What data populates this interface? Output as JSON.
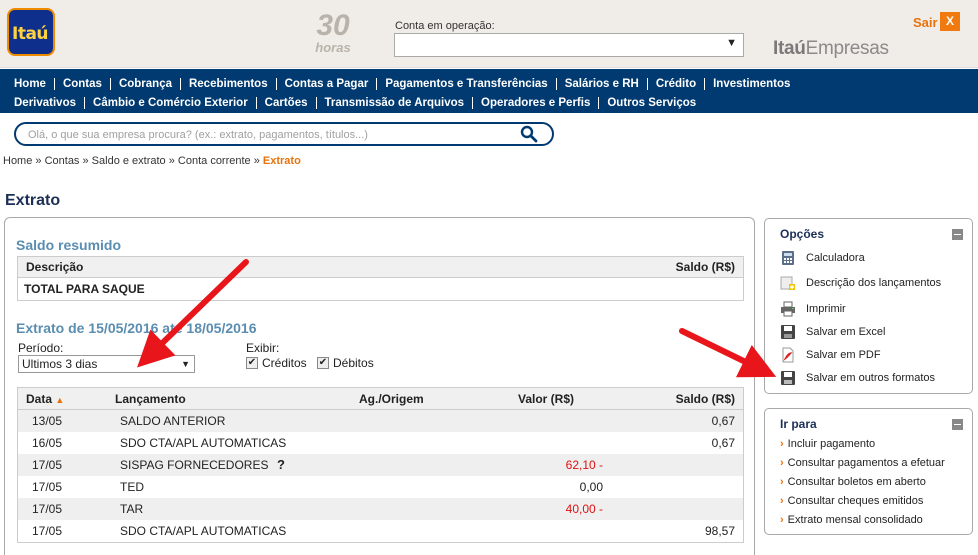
{
  "header": {
    "logo_text": "Itaú",
    "thirty": {
      "number": "30",
      "label": "horas"
    },
    "account_label": "Conta em operação:",
    "account_value": "",
    "brand_a": "Itaú",
    "brand_b": "Empresas",
    "logout_label": "Sair",
    "logout_x": "X"
  },
  "nav": {
    "row1": [
      "Home",
      "Contas",
      "Cobrança",
      "Recebimentos",
      "Contas a Pagar",
      "Pagamentos e Transferências",
      "Salários e RH",
      "Crédito",
      "Investimentos"
    ],
    "row2": [
      "Derivativos",
      "Câmbio e Comércio Exterior",
      "Cartões",
      "Transmissão de Arquivos",
      "Operadores e Perfis",
      "Outros Serviços"
    ]
  },
  "search": {
    "placeholder": "Olá, o que sua empresa procura? (ex.: extrato, pagamentos, títulos...)",
    "icon": "search-icon"
  },
  "breadcrumb": {
    "items": [
      "Home",
      "Contas",
      "Saldo e extrato",
      "Conta corrente"
    ],
    "separator": " » ",
    "current": "Extrato"
  },
  "page_title": "Extrato",
  "saldo": {
    "title": "Saldo resumido",
    "col_desc": "Descrição",
    "col_saldo": "Saldo (R$)",
    "row_label": "TOTAL PARA SAQUE"
  },
  "extrato": {
    "title": "Extrato de 15/05/2016 até 18/05/2016",
    "periodo_label": "Período:",
    "periodo_value": "Ultimos 3 dias",
    "exibir_label": "Exibir:",
    "creditos_label": "Créditos",
    "debitos_label": "Débitos",
    "creditos_checked": true,
    "debitos_checked": true,
    "columns": {
      "data": "Data",
      "lancamento": "Lançamento",
      "ag": "Ag./Origem",
      "valor": "Valor (R$)",
      "saldo": "Saldo (R$)"
    },
    "rows": [
      {
        "data": "13/05",
        "lancamento": "SALDO ANTERIOR",
        "valor": "",
        "saldo": "0,67",
        "negative": false
      },
      {
        "data": "16/05",
        "lancamento": "SDO CTA/APL AUTOMATICAS",
        "valor": "",
        "saldo": "0,67",
        "negative": false
      },
      {
        "data": "17/05",
        "lancamento": "SISPAG FORNECEDORES",
        "valor": "62,10 -",
        "saldo": "",
        "negative": true,
        "help": "?"
      },
      {
        "data": "17/05",
        "lancamento": "TED",
        "valor": "0,00",
        "saldo": "",
        "negative": false
      },
      {
        "data": "17/05",
        "lancamento": "TAR",
        "valor": "40,00 -",
        "saldo": "",
        "negative": true
      },
      {
        "data": "17/05",
        "lancamento": "SDO CTA/APL AUTOMATICAS",
        "valor": "",
        "saldo": "98,57",
        "negative": false
      }
    ]
  },
  "opcoes": {
    "title": "Opções",
    "items": [
      {
        "label": "Calculadora",
        "icon": "calculator-icon"
      },
      {
        "label": "Descrição dos lançamentos",
        "icon": "description-icon"
      },
      {
        "label": "Imprimir",
        "icon": "printer-icon"
      },
      {
        "label": "Salvar em Excel",
        "icon": "save-excel-icon"
      },
      {
        "label": "Salvar em PDF",
        "icon": "pdf-icon"
      },
      {
        "label": "Salvar em outros formatos",
        "icon": "save-other-icon"
      }
    ]
  },
  "ir_para": {
    "title": "Ir para",
    "items": [
      "Incluir pagamento",
      "Consultar pagamentos a efetuar",
      "Consultar boletos em aberto",
      "Consultar cheques emitidos",
      "Extrato mensal consolidado"
    ]
  },
  "colors": {
    "nav_bg": "#003a70",
    "accent_orange": "#e8730c",
    "section_blue": "#5a8db0",
    "negative_red": "#d11111",
    "annotation_arrow": "#e8161b"
  }
}
